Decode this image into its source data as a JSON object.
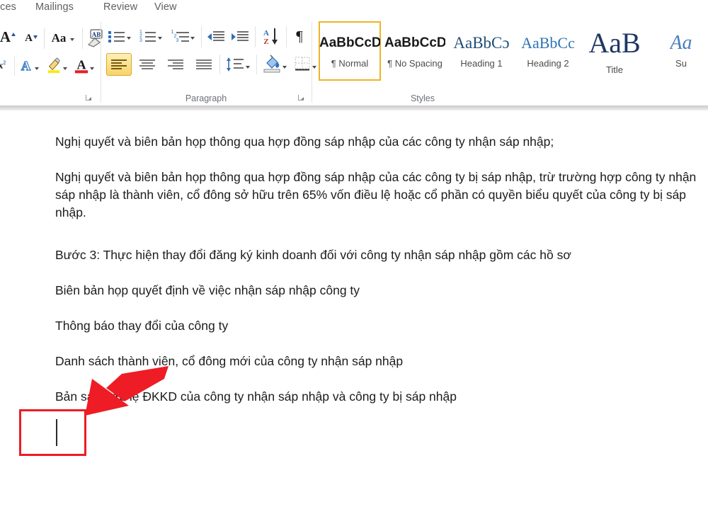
{
  "app": {
    "name": "Microsoft Word",
    "accent_yellow": "#f0b323",
    "accent_red": "#ee1c25",
    "text_color": "#1c1c1c"
  },
  "ribbon": {
    "tabs": [
      {
        "label": "nces",
        "name": "tab-references-cut"
      },
      {
        "label": "Mailings",
        "name": "tab-mailings"
      },
      {
        "label": "Review",
        "name": "tab-review"
      },
      {
        "label": "View",
        "name": "tab-view"
      }
    ],
    "groups": [
      {
        "label": "",
        "name": "font-group"
      },
      {
        "label": "Paragraph",
        "name": "paragraph-group"
      },
      {
        "label": "Styles",
        "name": "styles-group"
      }
    ],
    "font_group": {
      "label": "",
      "buttons": [
        {
          "name": "grow-font-button",
          "glyph": "A",
          "icon": "grow-font-icon"
        },
        {
          "name": "shrink-font-button",
          "glyph": "A",
          "icon": "shrink-font-icon"
        },
        {
          "name": "change-case-button",
          "glyph": "Aa",
          "icon": "change-case-icon"
        },
        {
          "name": "clear-formatting-button",
          "glyph": "A",
          "icon": "clear-formatting-icon"
        },
        {
          "name": "superscript-button",
          "glyph": "x²",
          "icon": "superscript-icon"
        },
        {
          "name": "text-effects-button",
          "glyph": "A",
          "icon": "text-effects-icon"
        },
        {
          "name": "text-highlight-color-button",
          "glyph": "",
          "icon": "highlighter-icon",
          "color": "#ffe800"
        },
        {
          "name": "font-color-button",
          "glyph": "A",
          "icon": "font-color-icon",
          "color": "#e41e26"
        }
      ]
    },
    "paragraph_group": {
      "label": "Paragraph",
      "row1": [
        {
          "name": "bullets-button",
          "icon": "bullet-list-icon"
        },
        {
          "name": "numbering-button",
          "icon": "numbered-list-icon"
        },
        {
          "name": "multilevel-list-button",
          "icon": "multilevel-list-icon"
        },
        {
          "name": "decrease-indent-button",
          "icon": "decrease-indent-icon"
        },
        {
          "name": "increase-indent-button",
          "icon": "increase-indent-icon"
        },
        {
          "name": "sort-button",
          "icon": "sort-az-icon",
          "glyph_top": "A",
          "glyph_bottom": "Z"
        },
        {
          "name": "show-hide-marks-button",
          "icon": "pilcrow-icon",
          "glyph": "¶"
        }
      ],
      "row2": [
        {
          "name": "align-left-button",
          "icon": "align-left-icon",
          "selected": true
        },
        {
          "name": "center-button",
          "icon": "align-center-icon",
          "selected": false
        },
        {
          "name": "align-right-button",
          "icon": "align-right-icon",
          "selected": false
        },
        {
          "name": "justify-button",
          "icon": "align-justify-icon",
          "selected": false
        },
        {
          "name": "line-spacing-button",
          "icon": "line-spacing-icon"
        },
        {
          "name": "shading-button",
          "icon": "shading-paint-bucket-icon"
        },
        {
          "name": "borders-button",
          "icon": "borders-icon"
        }
      ]
    },
    "styles_group": {
      "label": "Styles",
      "items": [
        {
          "name": "style-normal",
          "preview": "AaBbCcDc",
          "label": "¶ Normal",
          "selected": true,
          "preview_color": "#1a1a1a",
          "preview_font": "sans",
          "preview_size": 19
        },
        {
          "name": "style-no-spacing",
          "preview": "AaBbCcDc",
          "label": "¶ No Spacing",
          "selected": false,
          "preview_color": "#1a1a1a",
          "preview_font": "sans",
          "preview_size": 19
        },
        {
          "name": "style-heading-1",
          "preview": "AaBbCɔ",
          "label": "Heading 1",
          "selected": false,
          "preview_color": "#1f4e79",
          "preview_font": "serif",
          "preview_size": 22
        },
        {
          "name": "style-heading-2",
          "preview": "AaBbCc",
          "label": "Heading 2",
          "selected": false,
          "preview_color": "#2e74b5",
          "preview_font": "serif",
          "preview_size": 21
        },
        {
          "name": "style-title",
          "preview": "AaB",
          "label": "Title",
          "selected": false,
          "preview_color": "#1f3864",
          "preview_font": "serif",
          "preview_size": 36
        },
        {
          "name": "style-subtitle",
          "preview": "Aa",
          "label": "Su",
          "selected": false,
          "preview_color": "#4a7ebb",
          "preview_font": "serif",
          "preview_size": 26
        }
      ]
    }
  },
  "document": {
    "paragraphs": [
      {
        "name": "paragraph-1",
        "text": "Nghị quyết và biên bản họp thông qua hợp đồng sáp nhập của các công ty nhận sáp nhập;"
      },
      {
        "name": "paragraph-2",
        "text": "Nghị quyết và biên bản họp thông qua hợp đồng sáp nhập của các công ty bị sáp nhập, trừ trường hợp công ty nhận sáp nhập là thành viên, cổ đông sở hữu trên 65% vốn điều lệ hoặc cổ phần có quyền biểu quyết của công ty bị sáp nhập."
      },
      {
        "name": "paragraph-3",
        "text": "Bước 3: Thực hiện thay đổi đăng ký kinh doanh đối với công ty nhận sáp nhập gồm các hồ sơ"
      },
      {
        "name": "paragraph-4",
        "text": "Biên bản họp quyết định về việc nhận sáp nhập công ty"
      },
      {
        "name": "paragraph-5",
        "text": "Thông báo thay đổi của công ty"
      },
      {
        "name": "paragraph-6",
        "text": "Danh sách thành viên, cổ đông mới của công ty nhận sáp nhập"
      },
      {
        "name": "paragraph-7",
        "text": "Bản sao hợp lệ ĐKKD của công ty nhận sáp nhập và công ty bị sáp nhập"
      }
    ],
    "annotations": {
      "highlight_box": {
        "name": "red-highlight-box",
        "color": "#ee1c25"
      },
      "arrow": {
        "name": "red-pointer-arrow",
        "color": "#ee1c25",
        "direction": "down-left"
      },
      "caret": {
        "name": "text-cursor",
        "color": "#2b2b2b"
      }
    }
  }
}
